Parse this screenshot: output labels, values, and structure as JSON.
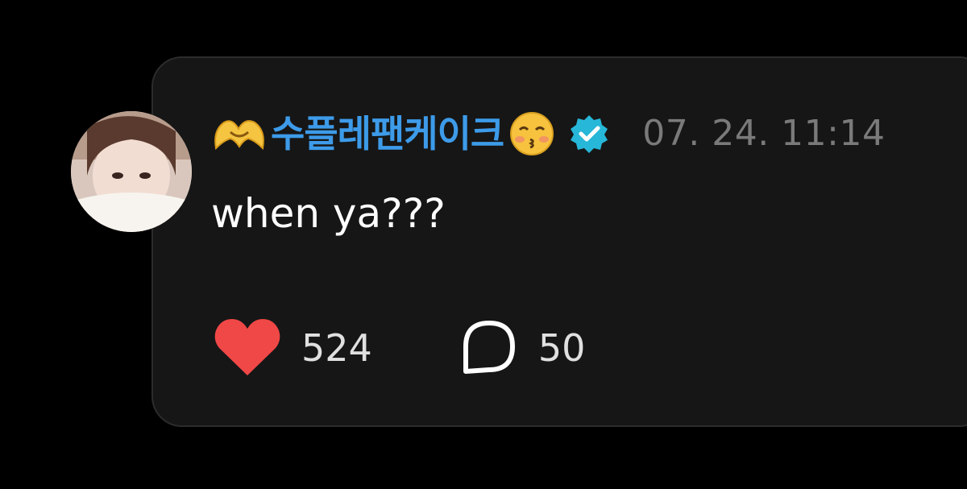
{
  "comment": {
    "username": "수플레팬케이크",
    "username_prefix_icon": "heart-hands-emoji",
    "username_suffix_icon": "kissing-face-emoji",
    "verified_icon": "verified-badge-icon",
    "timestamp": "07. 24. 11:14",
    "text": "when ya???",
    "likes": "524",
    "replies": "50"
  },
  "colors": {
    "background": "#000000",
    "card": "#161616",
    "username": "#3d9be9",
    "timestamp": "#7a7a7a",
    "text": "#ffffff",
    "heart": "#f04747",
    "verified": "#27b7d8"
  }
}
